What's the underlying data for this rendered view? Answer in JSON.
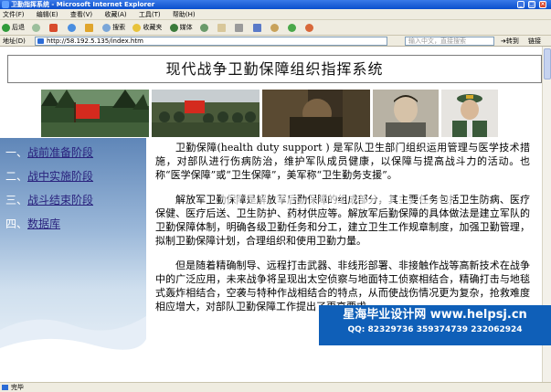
{
  "window": {
    "title": "卫勤指挥系统 - Microsoft Internet Explorer",
    "controls": [
      "_",
      "□",
      "×"
    ]
  },
  "menu": [
    "文件(F)",
    "编辑(E)",
    "查看(V)",
    "收藏(A)",
    "工具(T)",
    "帮助(H)"
  ],
  "toolbar": {
    "back": "后退",
    "search": "搜索",
    "favorites": "收藏夹",
    "media": "媒体"
  },
  "address": {
    "label": "地址(D)",
    "url": "http://58.192.5.135/index.htm",
    "ime_placeholder": "输入中文，直接搜索",
    "go": "转到",
    "links": "链接"
  },
  "page": {
    "header_title": "现代战争卫勤保障组织指挥系统",
    "nav": [
      {
        "num": "一、",
        "label": "战前准备阶段"
      },
      {
        "num": "二、",
        "label": "战中实施阶段"
      },
      {
        "num": "三、",
        "label": "战斗结束阶段"
      },
      {
        "num": "四、",
        "label": "数据库"
      }
    ],
    "paragraphs": [
      "卫勤保障(health duty support ) 是军队卫生部门组织运用管理与医学技术措施，对部队进行伤病防治，维护军队成员健康，以保障与提高战斗力的活动。也称“医学保障”或“卫生保障”，美军称“卫生勤务支援”。",
      "解放军卫勤保障是解放军后勤保障的组成部分，其主要任务包括卫生防病、医疗保健、医疗后送、卫生防护、药材供应等。解放军后勤保障的具体做法是建立军队的卫勤保障体制，明确各级卫勤任务和分工，建立卫生工作规章制度，加强卫勤管理，拟制卫勤保障计划，合理组织和使用卫勤力量。",
      "但是随着精确制导、远程打击武器、非线形部署、非接触作战等高新技术在战争中的广泛应用，未来战争将呈现出太空侦察与地面特工侦察相结合，精确打击与地毯式轰炸相结合，空袭与特种作战相结合的特点，从而使战伤情况更为复杂，抢救难度相应增大，对部队卫勤保障工作提出了更高要求。"
    ],
    "watermark": "www.helpsj.cn"
  },
  "ad": {
    "line1": "星海毕业设计网 www.helpsj.cn",
    "line2": "QQ: 82329736 359374739 232062924"
  },
  "status": {
    "text": "完毕"
  }
}
